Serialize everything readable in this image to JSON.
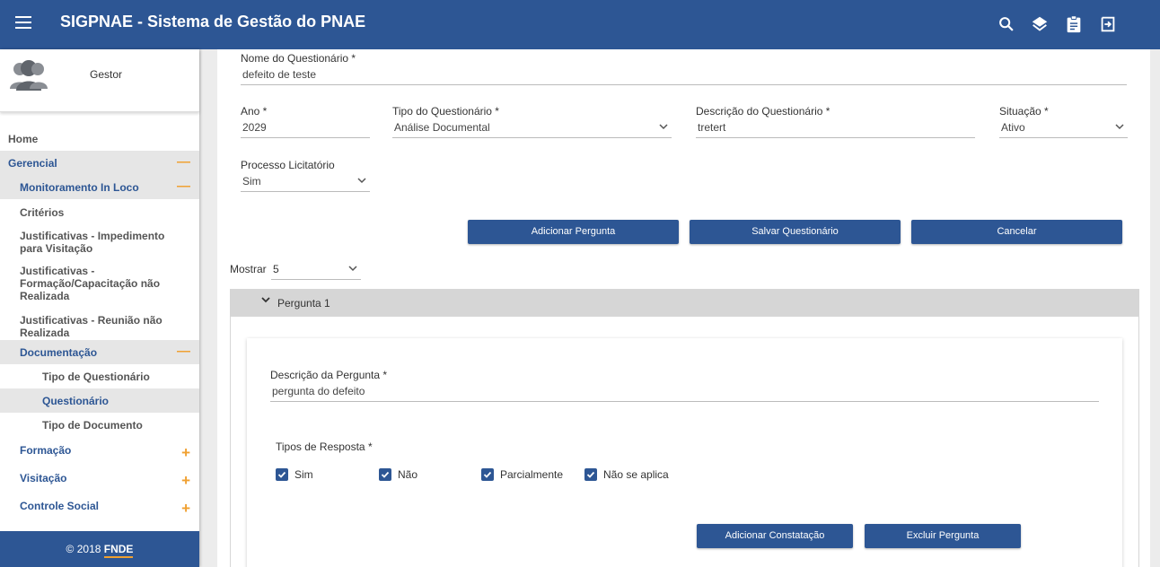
{
  "header": {
    "title": "SIGPNAE - Sistema de Gestão do PNAE"
  },
  "profile": {
    "name": "Gestor"
  },
  "sidebar": {
    "items": [
      {
        "label": "Home"
      },
      {
        "label": "Gerencial",
        "toggle": "—"
      },
      {
        "label": "Monitoramento In Loco",
        "toggle": "—"
      },
      {
        "label": "Critérios"
      },
      {
        "label": "Justificativas - Impedimento para Visitação"
      },
      {
        "label": "Justificativas - Formação/Capacitação não Realizada"
      },
      {
        "label": "Justificativas - Reunião não Realizada"
      },
      {
        "label": "Documentação",
        "toggle": "—"
      },
      {
        "label": "Tipo de Questionário"
      },
      {
        "label": "Questionário"
      },
      {
        "label": "Tipo de Documento"
      },
      {
        "label": "Formação",
        "toggle": "+"
      },
      {
        "label": "Visitação",
        "toggle": "+"
      },
      {
        "label": "Controle Social",
        "toggle": "+"
      }
    ],
    "footer_prefix": "© 2018 ",
    "footer_brand": "FNDE"
  },
  "form": {
    "nome": {
      "label": "Nome do Questionário *",
      "value": "defeito de teste"
    },
    "ano": {
      "label": "Ano *",
      "value": "2029"
    },
    "tipo": {
      "label": "Tipo do Questionário *",
      "value": "Análise Documental"
    },
    "descricao": {
      "label": "Descrição do Questionário *",
      "value": "tretert"
    },
    "situacao": {
      "label": "Situação *",
      "value": "Ativo"
    },
    "processo": {
      "label": "Processo Licitatório",
      "value": "Sim"
    }
  },
  "buttons": {
    "adicionar_pergunta": "Adicionar Pergunta",
    "salvar": "Salvar Questionário",
    "cancelar": "Cancelar",
    "adicionar_constatacao": "Adicionar Constatação",
    "excluir_pergunta": "Excluir Pergunta"
  },
  "mostrar": {
    "label": "Mostrar",
    "value": "5"
  },
  "pergunta": {
    "title": "Pergunta 1",
    "descricao_label": "Descrição da Pergunta *",
    "descricao_value": "pergunta do defeito",
    "tipos_label": "Tipos de Resposta *",
    "tipos": [
      {
        "label": "Sim",
        "checked": true
      },
      {
        "label": "Não",
        "checked": true
      },
      {
        "label": "Parcialmente",
        "checked": true
      },
      {
        "label": "Não se aplica",
        "checked": true
      }
    ]
  },
  "colors": {
    "primary": "#2d5694",
    "accent": "#f0a030"
  },
  "icons": [
    "menu-icon",
    "search-icon",
    "layers-icon",
    "clipboard-icon",
    "exit-icon",
    "avatar-icon",
    "chevron-down-icon",
    "checkbox-checked-icon"
  ]
}
